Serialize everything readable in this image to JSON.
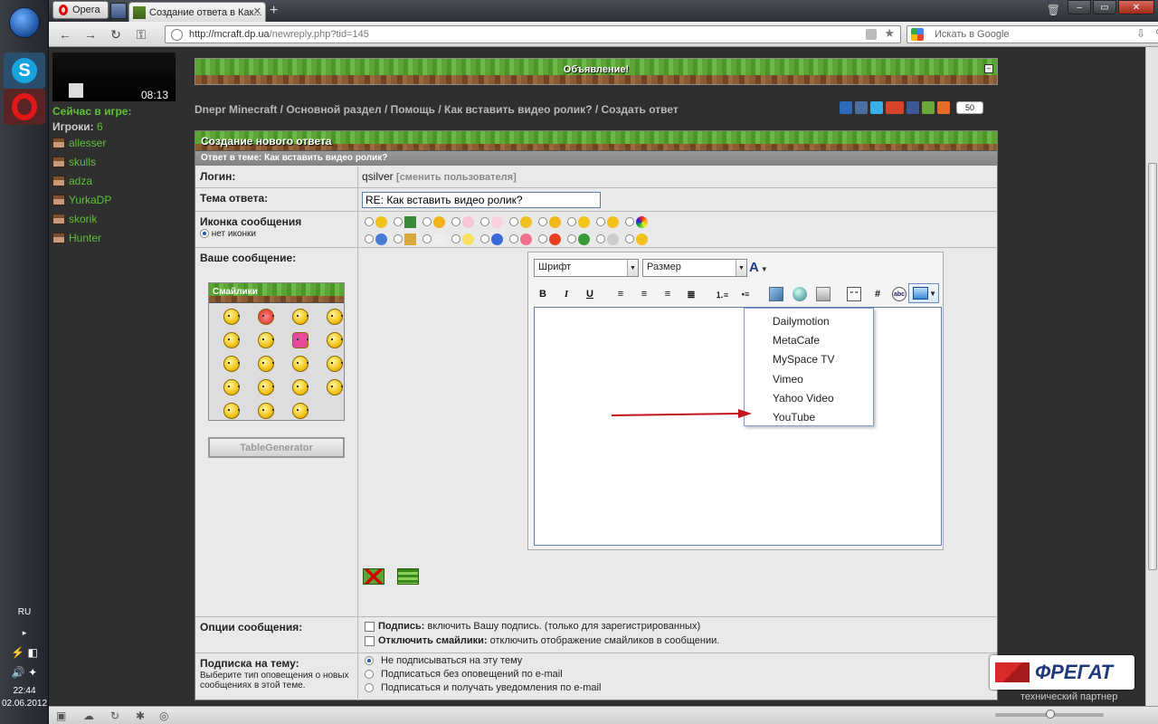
{
  "browser": {
    "menu_label": "Opera",
    "tab_title": "Создание ответа в Как...",
    "url_host": "http://mcraft.dp.ua",
    "url_path": "/newreply.php?tid=145",
    "search_placeholder": "Искать в Google"
  },
  "taskbar": {
    "lang": "RU",
    "time": "22:44",
    "date": "02.06.2012"
  },
  "sidebar": {
    "webcam_time": "08:13",
    "online_label": "Сейчас в игре:",
    "players_label": "Игроки:",
    "players_count": "6",
    "players": [
      "allesser",
      "skulls",
      "adza",
      "YurkaDP",
      "skorik",
      "Hunter"
    ]
  },
  "announcement": {
    "title": "Объявление!"
  },
  "breadcrumb": "Dnepr Minecraft / Основной раздел / Помощь / Как вставить видео ролик? / Создать ответ",
  "share": {
    "count": "50"
  },
  "form": {
    "header": "Создание нового ответа",
    "subheader": "Ответ в теме: Как вставить видео ролик?",
    "login_label": "Логин:",
    "login_value": "qsilver",
    "change_user": "[сменить пользователя]",
    "subject_label": "Тема ответа:",
    "subject_value": "RE: Как вставить видео ролик?",
    "icon_label": "Иконка сообщения",
    "no_icon": "нет иконки",
    "message_label": "Ваше сообщение:",
    "smilies_title": "Смайлики",
    "tablegen": "TableGenerator",
    "font_select": "Шрифт",
    "size_select": "Размер",
    "options_label": "Опции сообщения:",
    "opt_signature_b": "Подпись:",
    "opt_signature": "включить Вашу подпись. (только для зарегистрированных)",
    "opt_smilies_b": "Отключить смайлики:",
    "opt_smilies": "отключить отображение смайликов в сообщении.",
    "subscribe_label": "Подписка на тему:",
    "subscribe_hint": "Выберите тип оповещения о новых сообщениях в этой теме.",
    "subscribe_options": [
      "Не подписываться на эту тему",
      "Подписаться без оповещений по e-mail",
      "Подписаться и получать уведомления по e-mail"
    ]
  },
  "toolbar": {
    "bold": "B",
    "italic": "I",
    "underline": "U",
    "code": "#"
  },
  "video_menu": [
    "Dailymotion",
    "MetaCafe",
    "MySpace TV",
    "Vimeo",
    "Yahoo Video",
    "YouTube"
  ],
  "sponsor": {
    "name": "ФРЕГАТ",
    "tagline": "технический партнер"
  },
  "colors": {
    "accent_green": "#5fbf3a",
    "arrow_red": "#c0141a"
  }
}
